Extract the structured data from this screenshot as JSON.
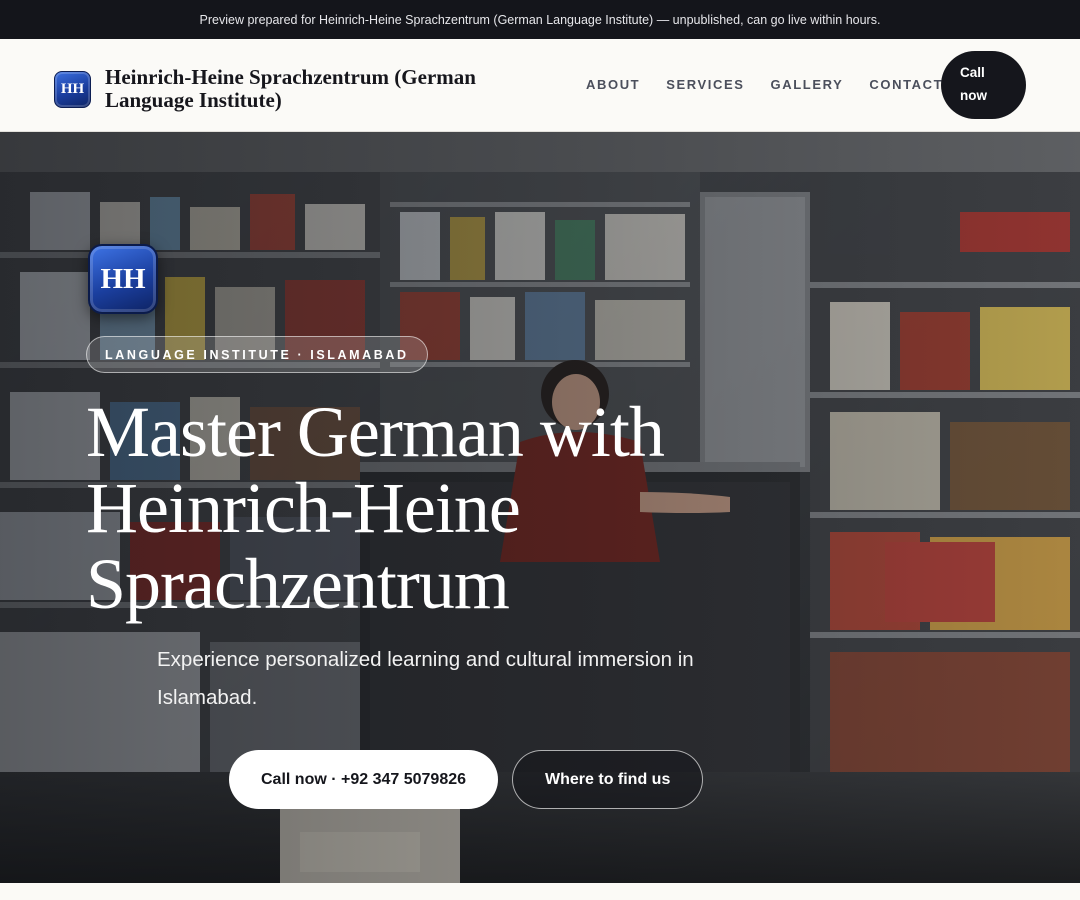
{
  "preview_bar": {
    "text": "Preview prepared for Heinrich-Heine Sprachzentrum (German Language Institute) — unpublished, can go live within hours."
  },
  "header": {
    "logo_text": "HH",
    "brand_name": "Heinrich-Heine Sprachzentrum (German Language Institute)",
    "nav": [
      "ABOUT",
      "SERVICES",
      "GALLERY",
      "CONTACT"
    ],
    "call_label_line1": "Call",
    "call_label_line2": "now"
  },
  "hero": {
    "logo_text": "HH",
    "badge": "LANGUAGE INSTITUTE · ISLAMABAD",
    "title": "Master German with Heinrich-Heine Sprachzentrum",
    "subtitle": "Experience personalized learning and cultural immersion in Islamabad.",
    "primary_cta": "Call now · +92 347 5079826",
    "secondary_cta": "Where to find us"
  },
  "colors": {
    "brand_blue": "#1a3d9e",
    "dark": "#15161c",
    "page_bg": "#fbfaf6"
  }
}
